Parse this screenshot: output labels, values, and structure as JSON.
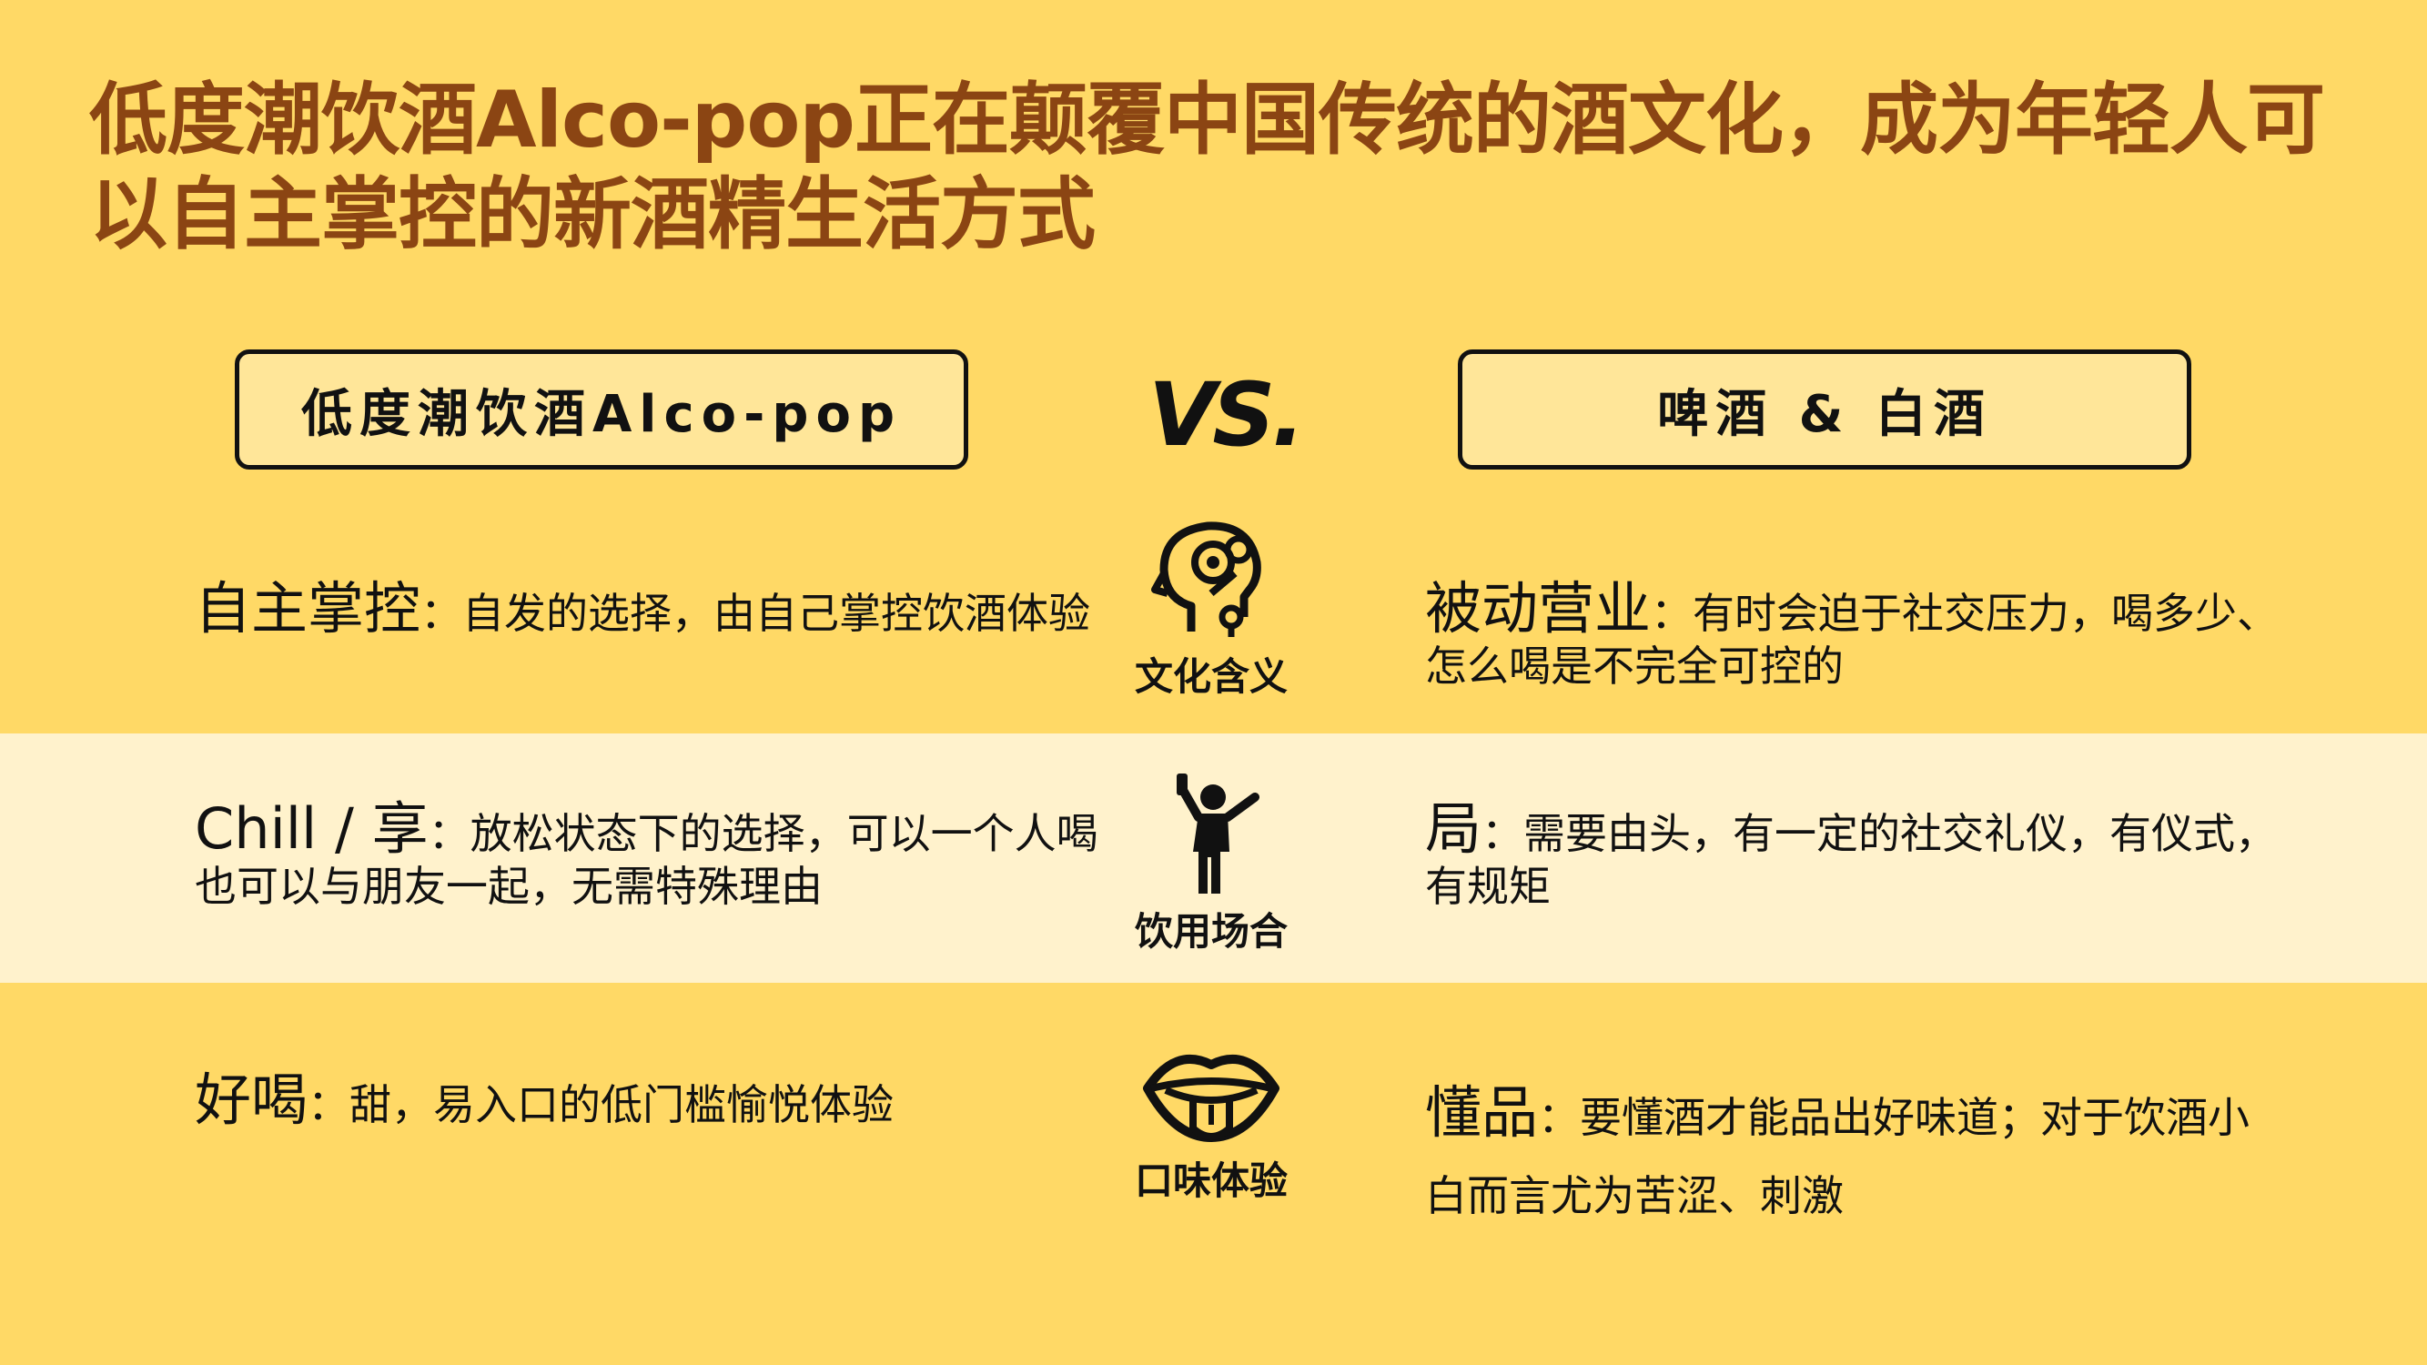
{
  "title": "低度潮饮酒Alco-pop正在颠覆中国传统的酒文化，成为年轻人可以自主掌控的新酒精生活方式",
  "header": {
    "left": "低度潮饮酒Alco-pop",
    "vs": "VS.",
    "right": "啤酒 & 白酒"
  },
  "rows": [
    {
      "icon": "head-gears-icon",
      "category": "文化含义",
      "left_key": "自主掌控",
      "left_text": "：自发的选择，由自己掌控饮酒体验",
      "right_key": "被动营业",
      "right_text": "：有时会迫于社交压力，喝多少、怎么喝是不完全可控的"
    },
    {
      "icon": "person-drinking-icon",
      "category": "饮用场合",
      "left_key": "Chill / 享",
      "left_text": "：放松状态下的选择，可以一个人喝也可以与朋友一起，无需特殊理由",
      "right_key": "局",
      "right_text": "：需要由头，有一定的社交礼仪，有仪式，有规矩"
    },
    {
      "icon": "mouth-tongue-icon",
      "category": "口味体验",
      "left_key": "好喝",
      "left_text": "：甜，易入口的低门槛愉悦体验",
      "right_key": "懂品",
      "right_text": "：要懂酒才能品出好味道；对于饮酒小白而言尤为苦涩、刺激"
    }
  ],
  "colors": {
    "background": "#FFD966",
    "band": "#FFF2CC",
    "header_box": "#FFE699",
    "title": "#8B4513"
  }
}
